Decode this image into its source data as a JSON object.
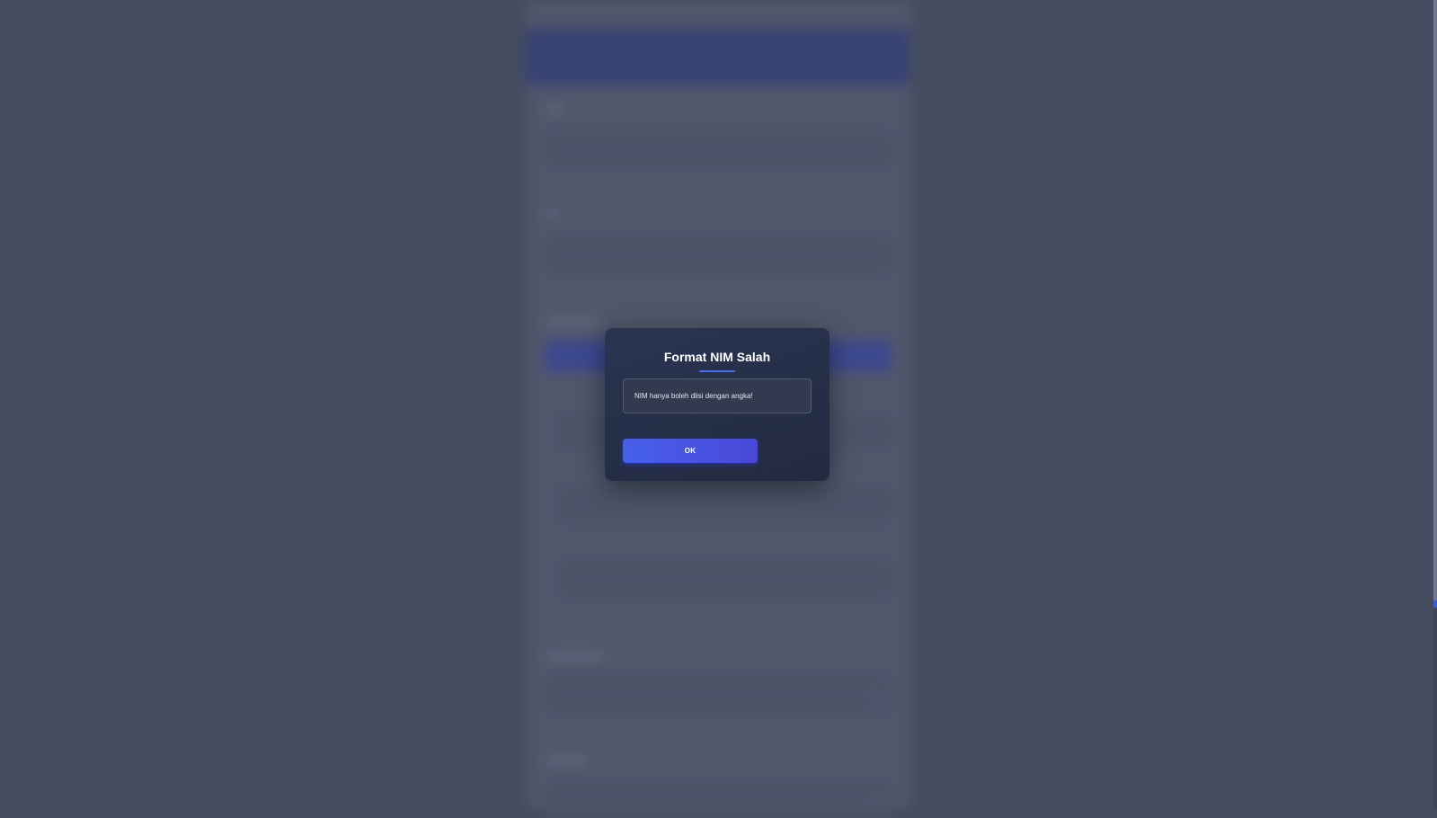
{
  "modal": {
    "title": "Format NIM Salah",
    "message": "NIM hanya boleh diisi dengan angka!",
    "ok_label": "OK"
  },
  "colors": {
    "overlay": "#454c5f",
    "modal_bg": "#262f48",
    "accent": "#4a6cf0",
    "button": "#4660ea"
  }
}
